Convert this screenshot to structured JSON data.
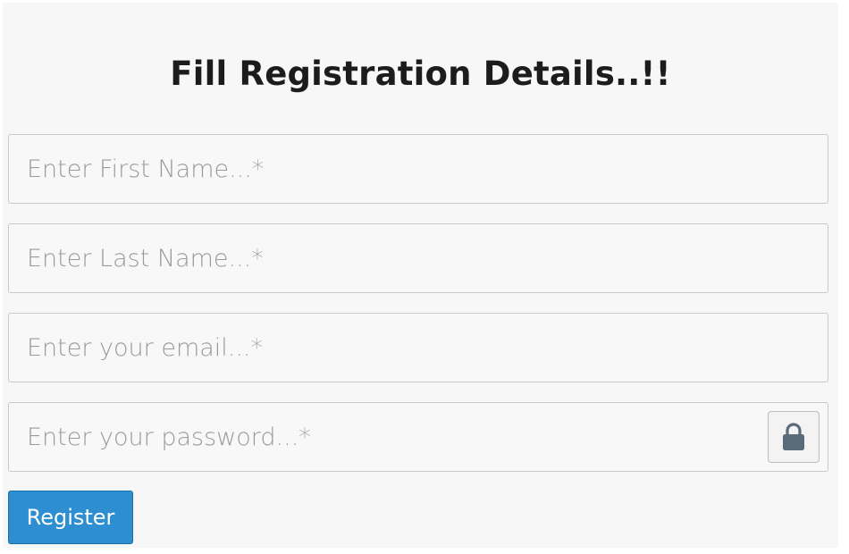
{
  "form": {
    "title": "Fill Registration Details..!!",
    "fields": [
      {
        "placeholder": "Enter First Name...*",
        "value": ""
      },
      {
        "placeholder": "Enter Last Name...*",
        "value": ""
      },
      {
        "placeholder": "Enter your email...*",
        "value": ""
      },
      {
        "placeholder": "Enter your password...*",
        "value": ""
      }
    ],
    "password_toggle_icon": "lock-icon",
    "register_label": "Register"
  },
  "colors": {
    "background": "#f7f7f7",
    "title": "#1c1c1c",
    "placeholder": "#9a9a9a",
    "field_border": "#c9c9c9",
    "button_bg": "#2d8fd1",
    "button_text": "#ffffff",
    "lock_icon": "#5b6b7a"
  }
}
